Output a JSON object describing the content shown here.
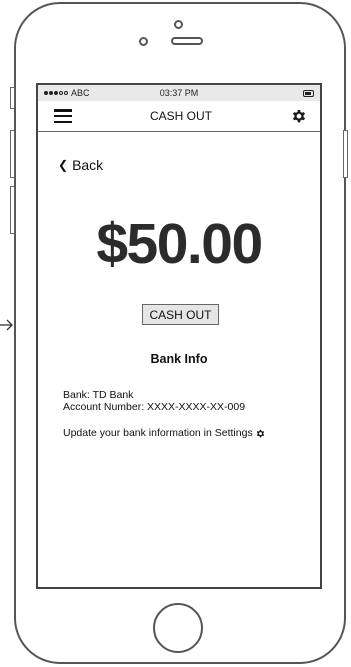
{
  "status_bar": {
    "carrier": "ABC",
    "time": "03:37 PM"
  },
  "nav": {
    "title": "CASH OUT",
    "menu_icon": "hamburger-menu-icon",
    "settings_icon": "gear-icon"
  },
  "back": {
    "label": "Back"
  },
  "balance": {
    "amount": "$50.00"
  },
  "actions": {
    "cash_out_label": "CASH OUT"
  },
  "bank_info": {
    "heading": "Bank Info",
    "bank_line": "Bank: TD Bank",
    "account_line": "Account Number: XXXX-XXXX-XX-009",
    "update_text": "Update your bank information in Settings"
  },
  "colors": {
    "frame": "#555555",
    "status_bar_bg": "#e9e9e9",
    "button_bg": "#e6e6e6",
    "amount_text": "#2b2b2b"
  }
}
